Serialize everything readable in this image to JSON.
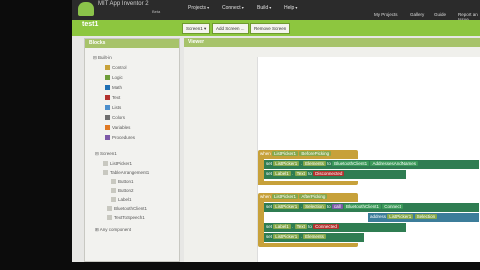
{
  "topbar": {
    "brand": "MIT App Inventor 2",
    "beta": "Beta",
    "menus": [
      "Projects",
      "Connect",
      "Build",
      "Help"
    ],
    "right": [
      "My Projects",
      "Gallery",
      "Guide",
      "Report an Issue"
    ]
  },
  "project": {
    "title": "test1",
    "screen_select": "Screen1",
    "add_screen": "Add Screen ...",
    "remove_screen": "Remove Screen"
  },
  "blocks_panel": {
    "header": "Blocks",
    "builtin": "Built-in",
    "items": [
      {
        "label": "Control",
        "color": "#c8a23a"
      },
      {
        "label": "Logic",
        "color": "#6f9d3a"
      },
      {
        "label": "Math",
        "color": "#1f6fb3"
      },
      {
        "label": "Text",
        "color": "#b3322e"
      },
      {
        "label": "Lists",
        "color": "#4d8fcc"
      },
      {
        "label": "Colors",
        "color": "#6e6e6e"
      },
      {
        "label": "Variables",
        "color": "#e07a23"
      },
      {
        "label": "Procedures",
        "color": "#7d5aa8"
      }
    ],
    "screen": "Screen1",
    "components": [
      "ListPicker1",
      "TableArrangement1",
      "Button1",
      "Button2",
      "Label1",
      "BluetoothClient1",
      "TextToSpeech1"
    ],
    "any": "Any component"
  },
  "viewer": {
    "header": "Viewer"
  },
  "blocks": {
    "when1": "when",
    "lp1": "ListPicker1",
    "ev1": "BeforePicking",
    "set1": "set",
    "lp1b": "ListPicker1",
    "elems": "Elements",
    "to1": "to",
    "bt1": "BluetoothClient1",
    "addr": "AddressesAndNames",
    "set2": "set",
    "lbl1": "Label1",
    "text1": "Text",
    "to2": "to",
    "disc": "Disconnected",
    "when2": "when",
    "lp2": "ListPicker1",
    "ev2": "AfterPicking",
    "set3": "set",
    "lp2b": "ListPicker1",
    "sel": "Selection",
    "to3": "to",
    "call": "call",
    "bt2": "BluetoothClient1",
    "connect": "Connect",
    "address": "address",
    "lp3": "ListPicker1",
    "sel2": "Selection",
    "set4": "set",
    "lbl2": "Label1",
    "text2": "Text",
    "to4": "to",
    "conn": "Connected",
    "set5": "set",
    "lp4": "ListPicker1",
    "elems2": "Elements"
  }
}
